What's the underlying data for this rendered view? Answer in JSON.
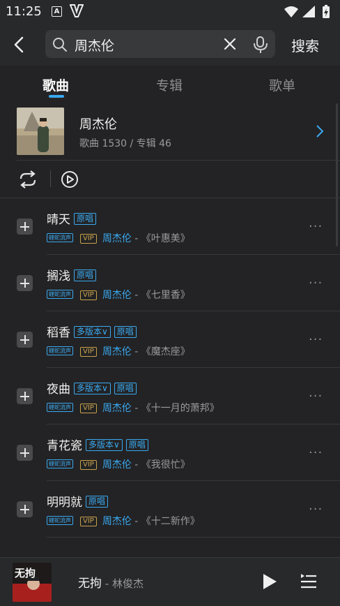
{
  "status": {
    "time": "11:25",
    "icon_a": "A"
  },
  "search": {
    "query": "周杰伦",
    "button": "搜索"
  },
  "tabs": [
    {
      "label": "歌曲"
    },
    {
      "label": "专辑"
    },
    {
      "label": "歌单"
    }
  ],
  "artist": {
    "name": "周杰伦",
    "meta": "歌曲 1530 / 专辑 46"
  },
  "songs": [
    {
      "title": "晴天",
      "tags": [
        "原唱"
      ],
      "quality": "蝰蛇流声",
      "vip": "VIP",
      "singer": "周杰伦",
      "album": " - 《叶惠美》"
    },
    {
      "title": "搁浅",
      "tags": [
        "原唱"
      ],
      "quality": "蝰蛇流声",
      "vip": "VIP",
      "singer": "周杰伦",
      "album": " - 《七里香》"
    },
    {
      "title": "稻香",
      "tags": [
        "多版本∨",
        "原唱"
      ],
      "quality": "蝰蛇流声",
      "vip": "VIP",
      "singer": "周杰伦",
      "album": " - 《魔杰座》"
    },
    {
      "title": "夜曲",
      "tags": [
        "多版本∨",
        "原唱"
      ],
      "quality": "蝰蛇流声",
      "vip": "VIP",
      "singer": "周杰伦",
      "album": " - 《十一月的萧邦》"
    },
    {
      "title": "青花瓷",
      "tags": [
        "多版本∨",
        "原唱"
      ],
      "quality": "蝰蛇流声",
      "vip": "VIP",
      "singer": "周杰伦",
      "album": " - 《我很忙》"
    },
    {
      "title": "明明就",
      "tags": [
        "原唱"
      ],
      "quality": "蝰蛇流声",
      "vip": "VIP",
      "singer": "周杰伦",
      "album": " - 《十二新作》"
    }
  ],
  "more_label": "···",
  "player": {
    "song": "无拘",
    "singer": " - 林俊杰",
    "cover_text": "无拘"
  },
  "colors": {
    "accent": "#3aa9f0",
    "background": "#232325",
    "bar": "#28292b",
    "vip": "#c9a24a"
  },
  "icons": [
    "back-arrow-icon",
    "search-icon",
    "clear-icon",
    "voice-search-icon",
    "chevron-right-icon",
    "loop-icon",
    "play-circle-icon",
    "add-icon",
    "more-icon",
    "play-icon",
    "playlist-icon"
  ]
}
